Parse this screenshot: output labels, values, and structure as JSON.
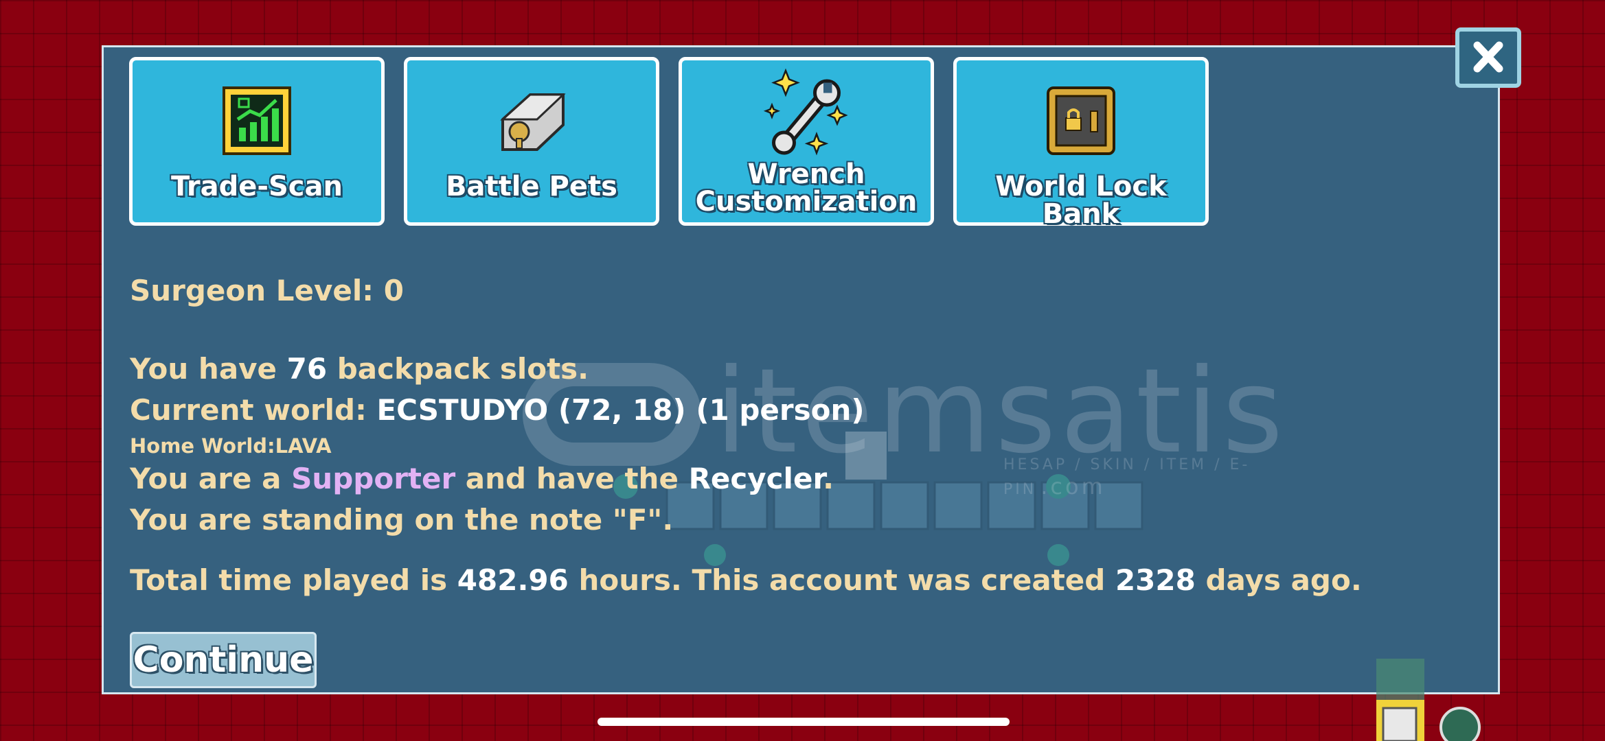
{
  "tiles": [
    {
      "label": "Trade-Scan",
      "icon": "trade-scan-icon"
    },
    {
      "label": "Battle Pets",
      "icon": "battle-pets-icon"
    },
    {
      "label_line1": "Wrench",
      "label_line2": "Customization",
      "icon": "wrench-icon"
    },
    {
      "label": "World Lock Bank",
      "icon": "world-lock-bank-icon"
    }
  ],
  "info": {
    "surgeon": "Surgeon Level: 0",
    "backpack_pre": "You have ",
    "backpack_num": "76",
    "backpack_post": " backpack slots.",
    "world_pre": "Current world: ",
    "world_val": "ECSTUDYO (72, 18) (1 person)",
    "home": "Home World:LAVA",
    "role_pre": "You are a ",
    "role": "Supporter",
    "role_mid": " and have the ",
    "role_item": "Recycler",
    "role_post": ".",
    "note": "You are standing on the note \"F\".",
    "time_pre": "Total time played is ",
    "time_val": "482.96",
    "time_mid": " hours.  This account was created ",
    "days_val": "2328",
    "time_post": " days ago."
  },
  "continue_label": "Continue",
  "close_icon": "close-icon",
  "watermark": {
    "text": "itemsatis",
    "sub": "HESAP / SKIN / ITEM / E-PIN",
    "dotcom": ".com"
  },
  "colors": {
    "panel": "#36617f",
    "tile": "#2fb6dc",
    "info_text": "#f3dcaa",
    "supporter": "#e2b2f4",
    "background": "#8a0010"
  }
}
